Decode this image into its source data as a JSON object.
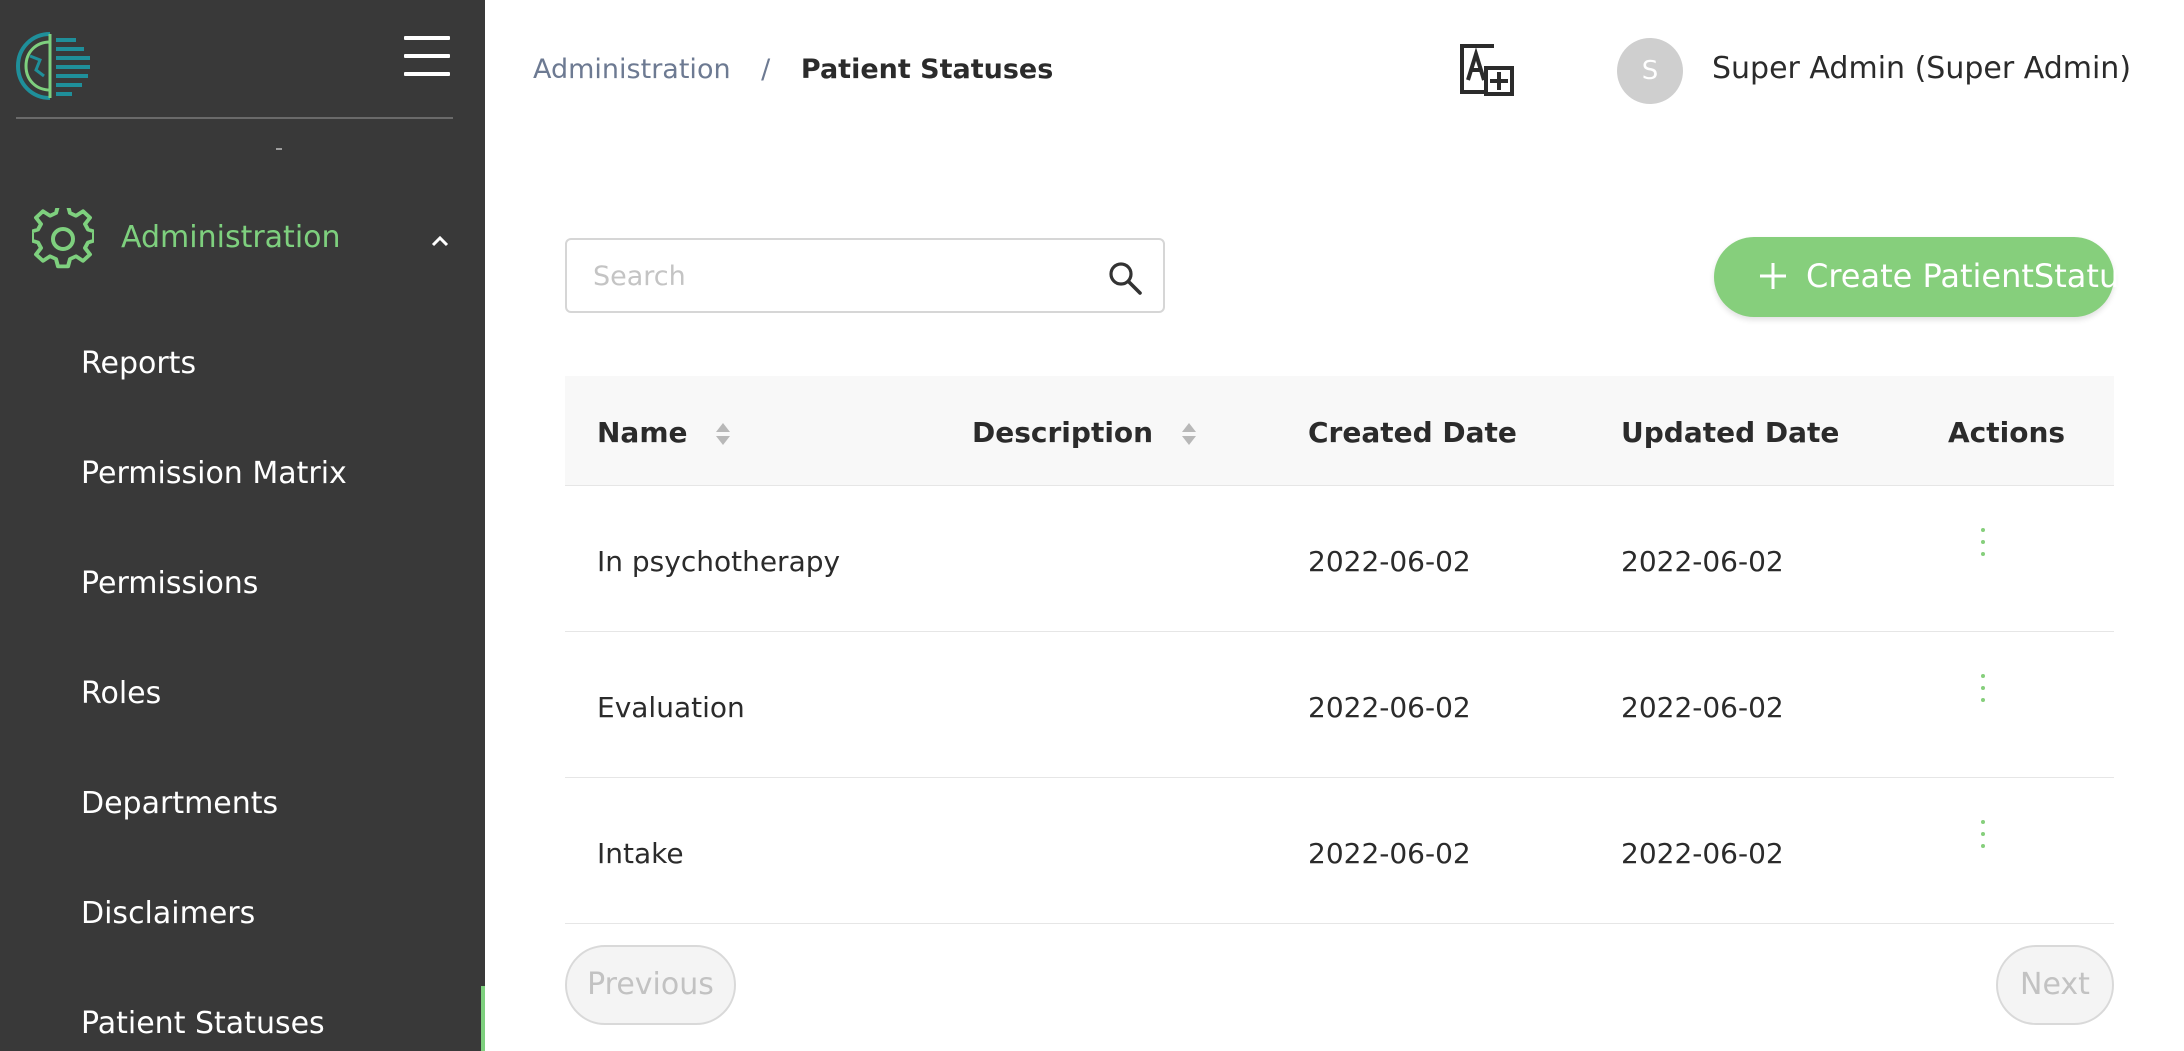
{
  "sidebar": {
    "admin_label": "Administration",
    "items": [
      {
        "label": "Reports"
      },
      {
        "label": "Permission Matrix"
      },
      {
        "label": "Permissions"
      },
      {
        "label": "Roles"
      },
      {
        "label": "Departments"
      },
      {
        "label": "Disclaimers"
      },
      {
        "label": "Patient Statuses"
      }
    ],
    "active_item": "Patient Statuses",
    "icons": [
      "brain-logo-icon",
      "hamburger-menu-icon",
      "gear-icon",
      "chevron-up-icon"
    ]
  },
  "header": {
    "breadcrumb": {
      "parent": "Administration",
      "separator": "/",
      "current": "Patient Statuses"
    },
    "translate_icon": "translate-icon",
    "avatar_initial": "S",
    "user_name": "Super Admin (Super Admin)"
  },
  "toolbar": {
    "search_placeholder": "Search",
    "search_value": "",
    "create_label": "Create PatientStatus"
  },
  "table": {
    "columns": {
      "name": "Name",
      "description": "Description",
      "created": "Created Date",
      "updated": "Updated Date",
      "actions": "Actions"
    },
    "rows": [
      {
        "name": "In psychotherapy",
        "description": "",
        "created": "2022-06-02",
        "updated": "2022-06-02"
      },
      {
        "name": "Evaluation",
        "description": "",
        "created": "2022-06-02",
        "updated": "2022-06-02"
      },
      {
        "name": "Intake",
        "description": "",
        "created": "2022-06-02",
        "updated": "2022-06-02"
      }
    ]
  },
  "pagination": {
    "previous_label": "Previous",
    "next_label": "Next"
  },
  "colors": {
    "sidebar_bg": "#393939",
    "accent_green": "#86cf7c",
    "sidebar_accent": "#7ed07e",
    "breadcrumb_link": "#6d7a92"
  }
}
